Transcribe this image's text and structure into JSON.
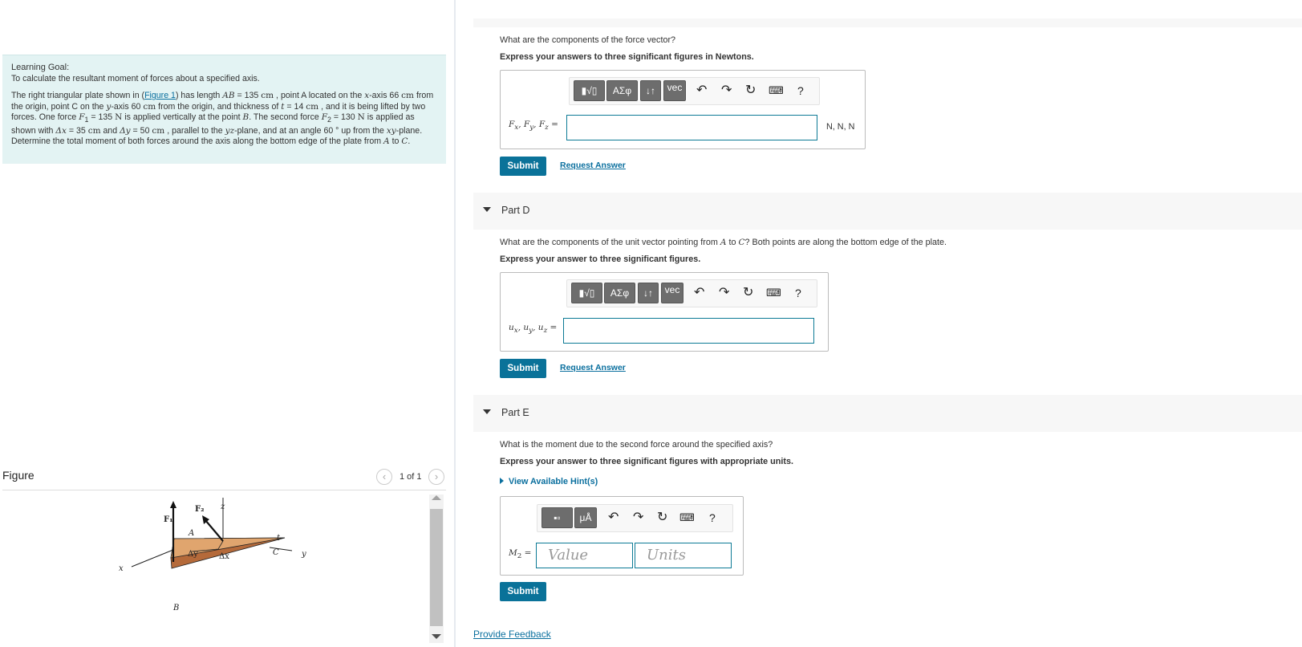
{
  "learning_goal": {
    "title": "Learning Goal:",
    "subtitle": "To calculate the resultant moment of forces about a specified axis.",
    "figure_link": "Figure 1",
    "text_parts": [
      "The right triangular plate shown in (",
      ") has length ",
      " = 135 ",
      " , point A located on the ",
      "-axis 66 ",
      " from the origin, point C on the ",
      "-axis 60 ",
      " from the origin, and thickness of ",
      " = 14 ",
      " , and it is being lifted by two forces. One force ",
      " = 135 ",
      " is applied vertically at the point ",
      ". The second force ",
      " = 130 ",
      " is applied as shown with ",
      " = 35 ",
      " and ",
      " = 50 ",
      " , parallel to the ",
      "-plane, and at an angle 60 ° up from the ",
      "-plane. Determine the total moment of both forces around the axis along the bottom edge of the plate from ",
      " to ",
      "."
    ],
    "math": {
      "AB": "AB",
      "cm": "cm",
      "x": "x",
      "y": "y",
      "t": "t",
      "F1": "F",
      "one": "1",
      "N": "N",
      "B": "B",
      "F2": "F",
      "two": "2",
      "dx": "Δx",
      "dy": "Δy",
      "yz": "yz",
      "xy": "xy",
      "A": "A",
      "C": "C"
    }
  },
  "figure": {
    "title": "Figure",
    "counter": "1 of 1",
    "labels": {
      "z": "z",
      "x": "x",
      "y": "y",
      "F1": "F₁",
      "F2": "F₂",
      "A": "A",
      "B": "B",
      "C": "C",
      "t": "t",
      "dy": "Δy",
      "dx": "Δx"
    },
    "colors": {
      "plate_top": "#e0a56e",
      "plate_side": "#b56a3a"
    }
  },
  "part_c": {
    "question": "What are the components of the force vector?",
    "instruction": "Express your answers to three significant figures in Newtons.",
    "toolbar": {
      "greek": "ΑΣφ",
      "sort": "↓↑",
      "vec": "vec",
      "undo": "↶",
      "redo": "↷",
      "reset": "↻",
      "keyboard": "⌨",
      "help": "?"
    },
    "label": "F_x, F_y, F_z =",
    "label_parts": [
      "F",
      "x",
      ", F",
      "y",
      ", F",
      "z",
      " ="
    ],
    "units": "N, N, N",
    "submit": "Submit",
    "request": "Request Answer"
  },
  "part_d": {
    "title": "Part D",
    "question_parts": [
      "What are the components of the unit vector pointing from ",
      "A",
      " to ",
      "C",
      "? Both points are along the bottom edge of the plate."
    ],
    "instruction": "Express your answer to three significant figures.",
    "label_parts": [
      "u",
      "x",
      ", u",
      "y",
      ", u",
      "z",
      " ="
    ],
    "toolbar": {
      "greek": "ΑΣφ",
      "sort": "↓↑",
      "vec": "vec",
      "undo": "↶",
      "redo": "↷",
      "reset": "↻",
      "keyboard": "⌨",
      "help": "?"
    },
    "submit": "Submit",
    "request": "Request Answer"
  },
  "part_e": {
    "title": "Part E",
    "question": "What is the moment due to the second force around the specified axis?",
    "instruction": "Express your answer to three significant figures with appropriate units.",
    "hints": "View Available Hint(s)",
    "toolbar": {
      "units": "μÅ",
      "undo": "↶",
      "redo": "↷",
      "reset": "↻",
      "keyboard": "⌨",
      "help": "?"
    },
    "label_parts": [
      "M",
      "2",
      " ="
    ],
    "value_placeholder": "Value",
    "units_placeholder": "Units",
    "submit": "Submit"
  },
  "feedback": "Provide Feedback"
}
